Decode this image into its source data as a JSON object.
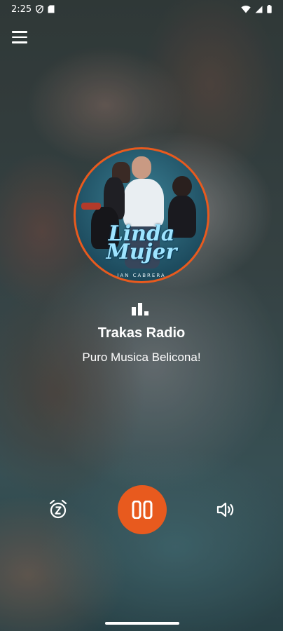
{
  "status_bar": {
    "time": "2:25"
  },
  "station": {
    "name": "Trakas Radio",
    "slogan": "Puro Musica Belicona!"
  },
  "album_art": {
    "title": "Linda Mujer",
    "artist": "IAN CABRERA"
  },
  "colors": {
    "accent": "#e85a1e"
  },
  "icons": {
    "menu": "hamburger-menu-icon",
    "sleep_timer": "alarm-sleep-icon",
    "play_pause": "pause-icon",
    "volume": "volume-icon",
    "equalizer": "equalizer-bars-icon"
  }
}
